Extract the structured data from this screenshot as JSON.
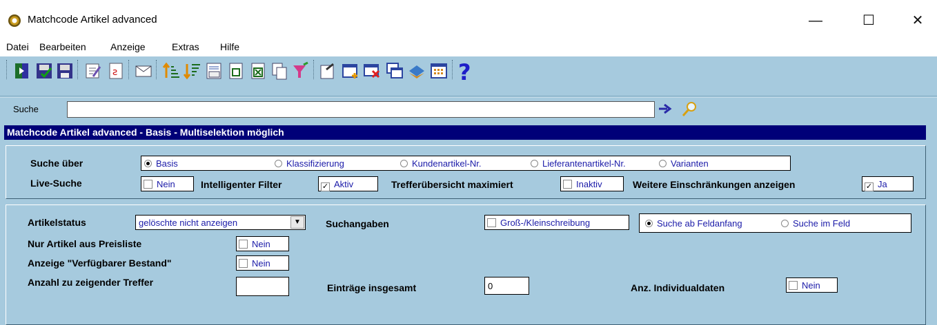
{
  "window": {
    "title": "Matchcode Artikel advanced",
    "minimize": "—",
    "maximize": "☐",
    "close": "✕"
  },
  "menu": {
    "items": [
      "Datei",
      "Bearbeiten",
      "Anzeige",
      "Extras",
      "Hilfe"
    ]
  },
  "search": {
    "label": "Suche",
    "value": ""
  },
  "header": {
    "title": "Matchcode Artikel advanced - Basis - Multiselektion möglich"
  },
  "basic": {
    "search_over_label": "Suche über",
    "options": [
      "Basis",
      "Klassifizierung",
      "Kundenartikel-Nr.",
      "Lieferantenartikel-Nr.",
      "Varianten"
    ],
    "live_search": {
      "label": "Live-Suche",
      "value": "Nein"
    },
    "smart_filter": {
      "label": "Intelligenter Filter",
      "value": "Aktiv"
    },
    "hits_max": {
      "label": "Trefferübersicht maximiert",
      "value": "Inaktiv"
    },
    "more_limits": {
      "label": "Weitere Einschränkungen anzeigen",
      "value": "Ja"
    }
  },
  "limits": {
    "status": {
      "label": "Artikelstatus",
      "value": "gelöschte nicht anzeigen"
    },
    "search_info_label": "Suchangaben",
    "case_sensitive": "Groß-/Kleinschreibung",
    "from_start": "Suche ab Feldanfang",
    "in_field": "Suche im Feld",
    "price_list": {
      "label": "Nur Artikel aus Preisliste",
      "value": "Nein"
    },
    "available_stock": {
      "label": "Anzeige \"Verfügbarer Bestand\"",
      "value": "Nein"
    },
    "count": {
      "label": "Anzahl zu zeigender Treffer",
      "value": ""
    },
    "total": {
      "label": "Einträge insgesamt",
      "value": "0"
    },
    "individual": {
      "label": "Anz. Individualdaten",
      "value": "Nein"
    }
  },
  "colors": {
    "background": "#a6cade",
    "header": "#000078",
    "value_text": "#1a1aa8"
  },
  "toolbar_icons": [
    "exit-icon",
    "save-close-icon",
    "save-icon",
    "edit-icon",
    "refresh-icon",
    "mail-icon",
    "sort-ascending-icon",
    "sort-descending-icon",
    "number-list-icon",
    "export-icon",
    "excel-icon",
    "copy-icon",
    "filter-icon",
    "settings-icon",
    "add-window-icon",
    "delete-window-icon",
    "windows-icon",
    "book-icon",
    "grid-icon",
    "help-icon"
  ]
}
